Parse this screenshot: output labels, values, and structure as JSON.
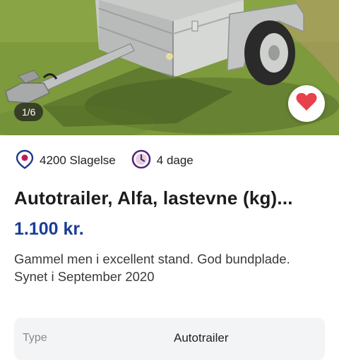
{
  "listing": {
    "image_counter": "1/6",
    "favorite_icon": "heart-icon",
    "favorite_color": "#e8414b",
    "location": "4200 Slagelse",
    "location_icon": "location-pin-icon",
    "age": "4 dage",
    "age_icon": "clock-icon",
    "accent_color": "#4a2a7a",
    "title": "Autotrailer, Alfa, lastevne (kg)...",
    "price": "1.100 kr.",
    "price_color": "#1a3d96",
    "description_line1": "Gammel men i excellent stand. God bundplade.",
    "description_line2": "Synet i September 2020",
    "specs": [
      {
        "label": "Type",
        "value": "Autotrailer"
      }
    ]
  }
}
